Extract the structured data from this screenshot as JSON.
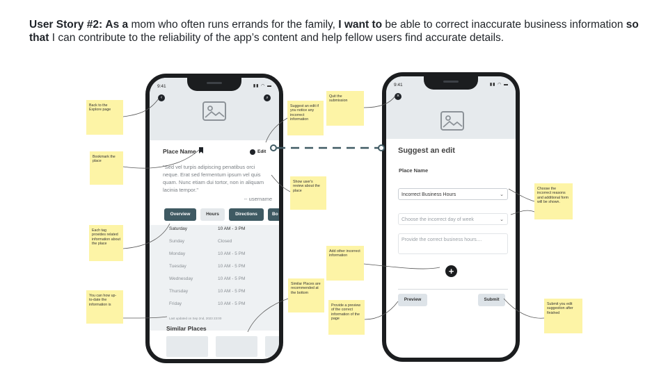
{
  "story": {
    "label": "User Story #2:",
    "as_a": "As a",
    "persona": " mom who often runs errands for the family, ",
    "i_want_to": "I want to",
    "goal": " be able to correct inaccurate business information ",
    "so_that": "so that",
    "benefit": " I can contribute to the reliability of the app’s content and help fellow users find accurate details."
  },
  "phone1": {
    "status_time": "9:41",
    "status_icons": "▮▮ ◠ ▬",
    "back_icon_glyph": "‹",
    "search_icon_glyph": "⌕",
    "place_name": "Place Name",
    "edit_label": "Edit",
    "review": "\"Sed vel turpis adipiscing penatibus orci neque. Erat sed fermentum ipsum vel quis quam. Nunc etiam dui tortor, non in aliquam lacinia tempor.\"",
    "username": "-- username",
    "tags": [
      "Overview",
      "Hours",
      "Directions",
      "Bo"
    ],
    "hours": [
      {
        "day": "Saturday",
        "time": "10 AM - 3 PM"
      },
      {
        "day": "Sunday",
        "time": "Closed"
      },
      {
        "day": "Monday",
        "time": "10 AM - 5 PM"
      },
      {
        "day": "Tuesday",
        "time": "10 AM - 5 PM"
      },
      {
        "day": "Wednesday",
        "time": "10 AM - 5 PM"
      },
      {
        "day": "Thursday",
        "time": "10 AM - 5 PM"
      },
      {
        "day": "Friday",
        "time": "10 AM - 5 PM"
      }
    ],
    "updated": "Last updated on Sep 2nd, 2023 23:00",
    "similar_places": "Similar Places"
  },
  "phone2": {
    "status_time": "9:41",
    "status_icons": "▮▮ ◠ ▬",
    "back_icon_glyph": "×",
    "title": "Suggest an edit",
    "place_name": "Place Name",
    "reason_select": "Incorrect Business Hours",
    "day_placeholder": "Choose the incorrect day of week",
    "hours_placeholder": "Provide the correct business hours....",
    "add_glyph": "+",
    "preview_label": "Preview",
    "submit_label": "Submit"
  },
  "notes": {
    "back": "Back to the Explore page",
    "bookmark": "Bookmark the place",
    "tags": "Each tag provides related information about the place",
    "uptodate": "You can how up-to-date the information is",
    "suggest": "Suggest an edit if you notice any incorrect information",
    "review": "Show user's review about the place",
    "similar": "Similar Places are recommended at the bottom",
    "quit": "Quit the submission",
    "add": "Add other incorrect information",
    "preview": "Provide a preview of the correct information of the page",
    "reasons": "Choose the incorrect reasons and additional form will be shown.",
    "submit": "Submit you edit suggestion after finished"
  },
  "colors": {
    "note": "#fdf4a6",
    "tag_dark": "#3f5a63",
    "connector": "#3f5a63"
  }
}
